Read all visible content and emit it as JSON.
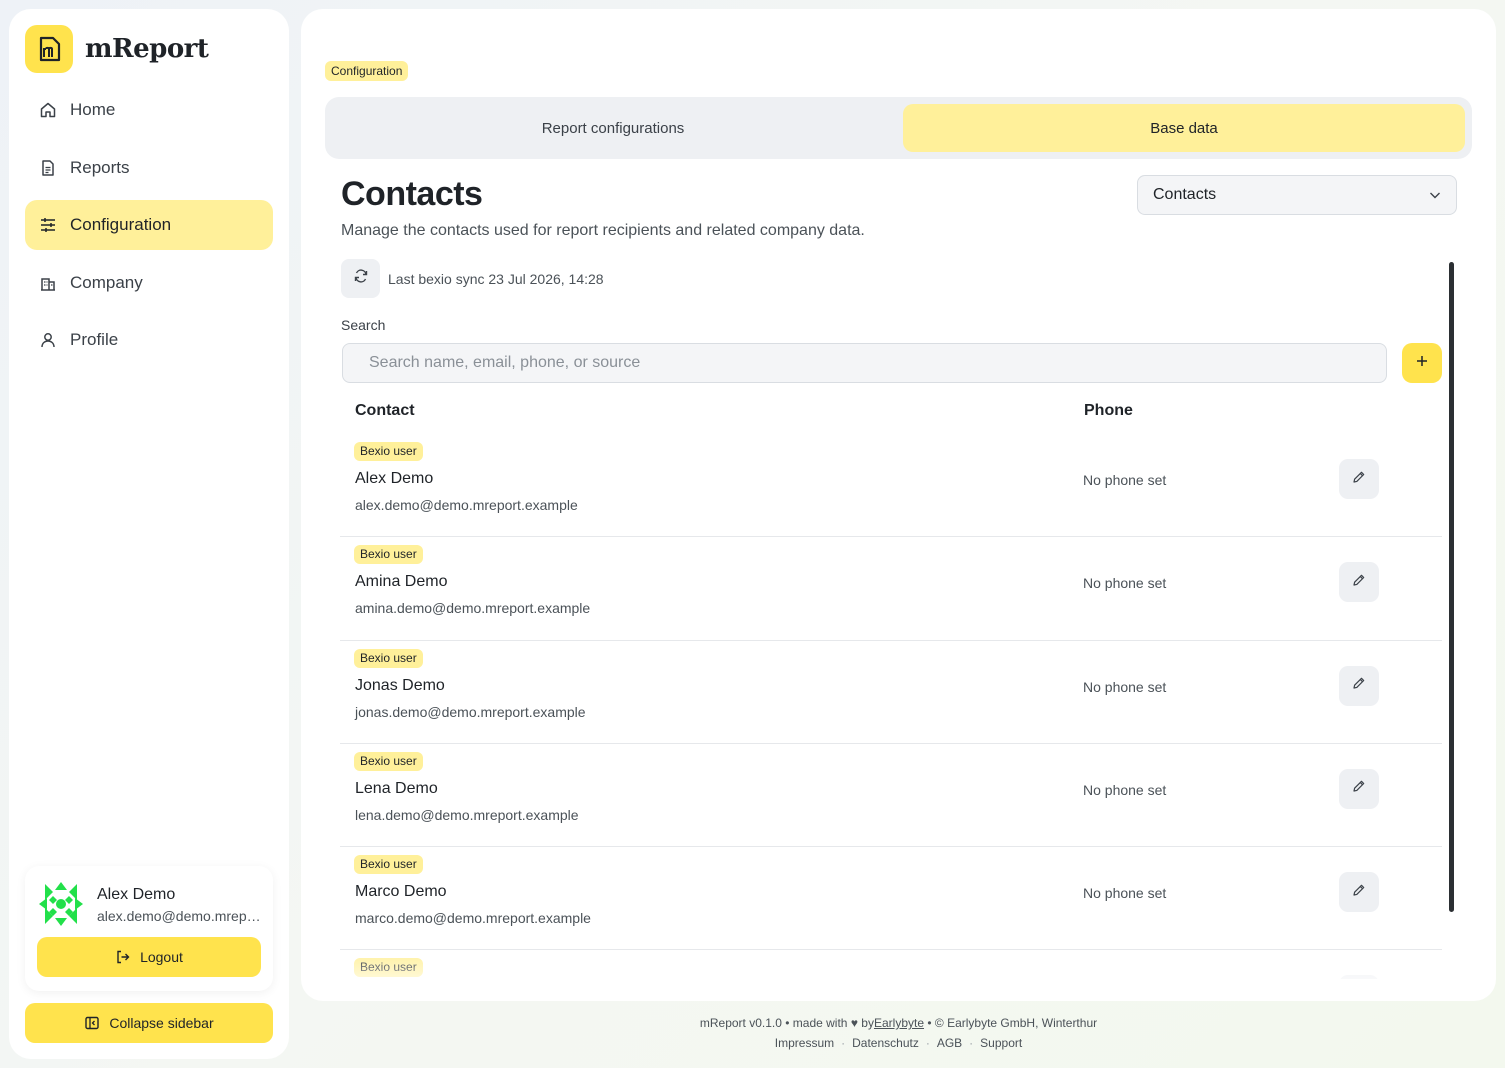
{
  "app": {
    "name": "mReport"
  },
  "sidebar": {
    "items": [
      {
        "label": "Home",
        "icon": "home-icon"
      },
      {
        "label": "Reports",
        "icon": "reports-icon"
      },
      {
        "label": "Configuration",
        "icon": "sliders-icon",
        "active": true
      },
      {
        "label": "Company",
        "icon": "building-icon"
      },
      {
        "label": "Profile",
        "icon": "user-icon"
      }
    ],
    "user": {
      "name": "Alex Demo",
      "email": "alex.demo@demo.mreport.example"
    },
    "logout_label": "Logout",
    "collapse_label": "Collapse sidebar"
  },
  "main": {
    "breadcrumb": "Configuration",
    "tabs": [
      {
        "label": "Report configurations",
        "active": false
      },
      {
        "label": "Base data",
        "active": true
      }
    ],
    "title": "Contacts",
    "subtitle": "Manage the contacts used for report recipients and related company data.",
    "select_value": "Contacts",
    "sync_text": "Last bexio sync 23 Jul 2026, 14:28",
    "search_label": "Search",
    "search_placeholder": "Search name, email, phone, or source",
    "table": {
      "headers": {
        "contact": "Contact",
        "phone": "Phone"
      },
      "rows": [
        {
          "badge": "Bexio user",
          "name": "Alex Demo",
          "email": "alex.demo@demo.mreport.example",
          "phone": "No phone set"
        },
        {
          "badge": "Bexio user",
          "name": "Amina Demo",
          "email": "amina.demo@demo.mreport.example",
          "phone": "No phone set"
        },
        {
          "badge": "Bexio user",
          "name": "Jonas Demo",
          "email": "jonas.demo@demo.mreport.example",
          "phone": "No phone set"
        },
        {
          "badge": "Bexio user",
          "name": "Lena Demo",
          "email": "lena.demo@demo.mreport.example",
          "phone": "No phone set"
        },
        {
          "badge": "Bexio user",
          "name": "Marco Demo",
          "email": "marco.demo@demo.mreport.example",
          "phone": "No phone set"
        },
        {
          "badge": "Bexio user",
          "name": "",
          "email": "",
          "phone": ""
        }
      ]
    }
  },
  "footer": {
    "line1_prefix": "mReport v0.1.0 • made with",
    "line1_by": "by",
    "line1_link": "Earlybyte",
    "line1_suffix": "• © Earlybyte GmbH, Winterthur",
    "links": [
      "Impressum",
      "Datenschutz",
      "AGB",
      "Support"
    ]
  },
  "colors": {
    "accent": "#ffe34d",
    "accent_soft": "#fff09a",
    "avatar": "#22e04a"
  }
}
